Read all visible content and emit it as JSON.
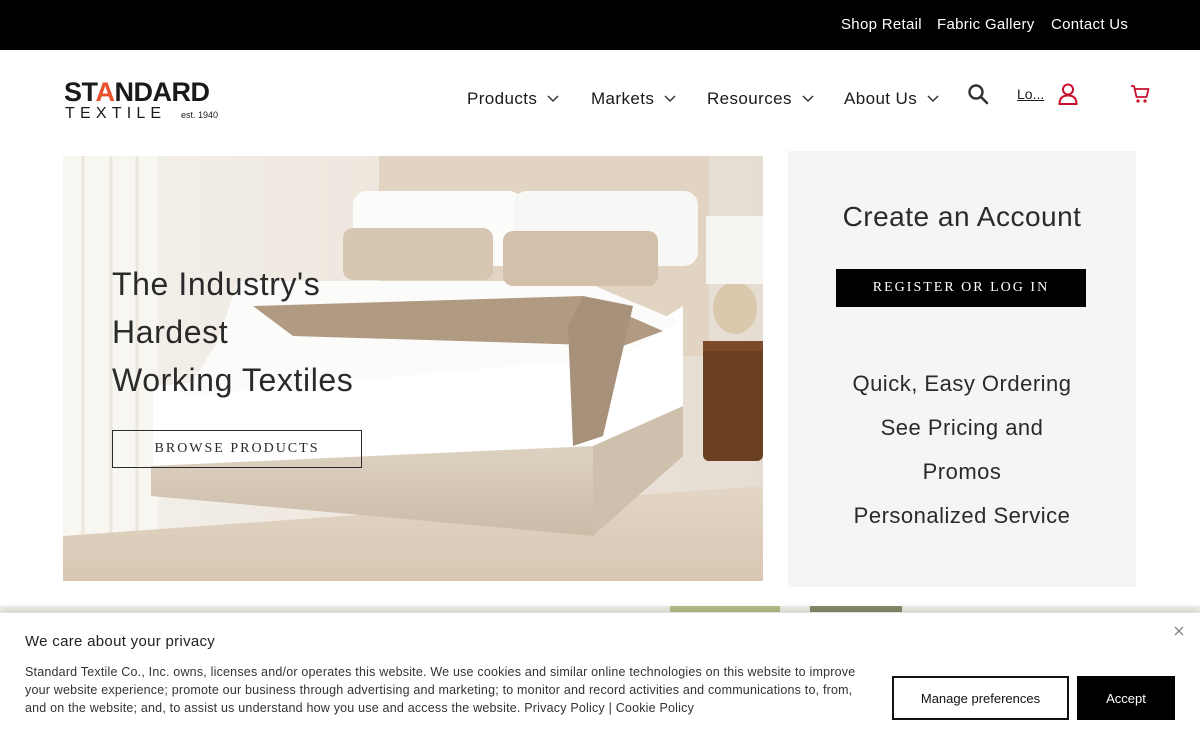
{
  "topbar": {
    "links": [
      "Shop Retail",
      "Fabric Gallery",
      "Contact Us"
    ]
  },
  "logo": {
    "line1_a": "ST",
    "line1_accent": "A",
    "line1_b": "NDARD",
    "line2": "TEXTILE",
    "est": "est. 1940"
  },
  "nav": {
    "items": [
      "Products",
      "Markets",
      "Resources",
      "About Us"
    ],
    "login_label": "Lo...",
    "icons": [
      "search-icon",
      "user-icon",
      "cart-icon"
    ]
  },
  "hero": {
    "headline": [
      "The Industry's",
      "Hardest",
      "Working Textiles"
    ],
    "button_label": "BROWSE PRODUCTS"
  },
  "account": {
    "title": "Create an Account",
    "button_label": "REGISTER OR LOG IN",
    "benefits": [
      "Quick, Easy Ordering",
      "See Pricing and",
      "Promos",
      "Personalized Service"
    ]
  },
  "cookie": {
    "title": "We care about your privacy",
    "body": "Standard Textile Co., Inc. owns, licenses and/or operates this website. We use cookies and similar online technologies on this website to improve your website experience; promote our business through advertising and marketing; to monitor and record activities and communications to, from, and on the website; and, to assist us understand how you use and access the website.",
    "privacy_link": "Privacy Policy",
    "separator": "|",
    "cookie_link": "Cookie Policy",
    "manage_label": "Manage preferences",
    "accept_label": "Accept"
  },
  "colors": {
    "topbar_bg": "#000000",
    "brand_accent": "#e8502a",
    "icon_red": "#c8102e",
    "panel_bg": "#f5f5f5"
  }
}
